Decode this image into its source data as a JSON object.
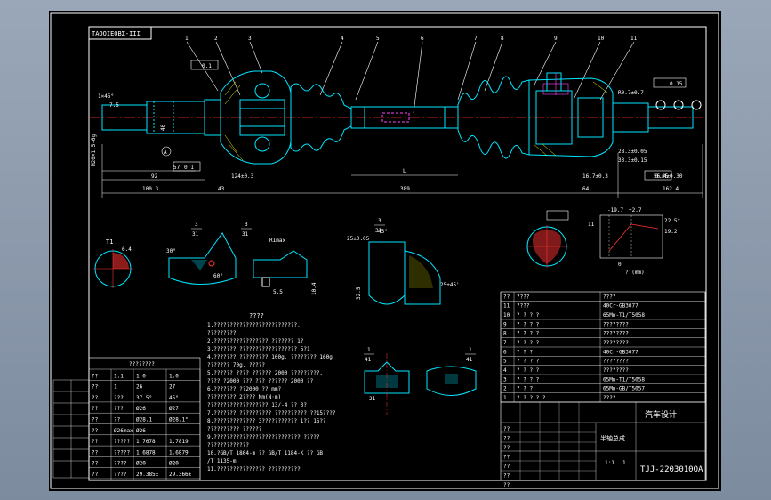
{
  "drawing": {
    "code_top": "ΤΑΟΟΙΕΟΒΣ-ΙΙΙ",
    "code_bottom": "TJJ-2203010OA",
    "company": "汽车设计",
    "part_name": "半轴总成",
    "technical_title": "????"
  },
  "balloons": [
    "1",
    "2",
    "3",
    "4",
    "5",
    "6",
    "7",
    "8",
    "9",
    "10",
    "11"
  ],
  "dimensions": {
    "d_100": "100.3",
    "d_43": "43",
    "d_389": "389",
    "d_64": "64",
    "d_162": "162.4",
    "d_92": "92",
    "d_57": "57",
    "d_124": "124±0.3",
    "d_167": "16.7±0.3",
    "d_564": "56.4±0.30",
    "d_L": "L",
    "d_283": "28.3±0.05",
    "d_333": "33.3±0.15",
    "ang_45": "1×45°",
    "d_75": "7.5",
    "m20": "M20×1.5-6g",
    "d_40": "40",
    "fig_a": "A",
    "d_r0": "R0.7±0.7",
    "tol_01": "0.1",
    "tol_015": "0.15",
    "tol_005": "0.05"
  },
  "sections": {
    "t1_label": "T1",
    "t1_w": "6.4",
    "s1_num": "3",
    "s1_den": "31",
    "s2_num": "3",
    "s2_den": "31",
    "s3_num": "3",
    "s3_den": "31",
    "s4_num": "1",
    "s4_den": "41",
    "s5_num": "1",
    "s5_den": "41",
    "ang_30": "30°",
    "ang_60": "60°",
    "ang_45b": "45°",
    "ang_25": "25±45'",
    "r_max": "R1max",
    "d_55": "5.5",
    "d_25": "25±0.05",
    "d_104": "10.4",
    "d_325": "32.5",
    "d_21": "21"
  },
  "graph": {
    "x_label": "? (mm)",
    "v1": "22.5°",
    "v2": "19.2",
    "top": "-19.7",
    "top2": "+2.7",
    "zero": "0",
    "n11": "11"
  },
  "notes": {
    "heading": "????",
    "lines": [
      "1.??????????????????????????,",
      "  ?????????",
      "2.????????????????? ??????? 1?",
      "3.??????? ?????????????????? 5?1",
      "4.??????? ????????? 100g,      ???????? 160g",
      "  ??????? 70g,      ?????",
      "5.?????? ???? ?????? 2000 ?????????.",
      "  ???? ?2000 ??? ??? ?????? 2000 ??",
      "6.??????? ??2000 ?? mm?",
      "  ????????? 2???? Nm(N·m)",
      "  ??????????????????? 13/-4 ?? 3?",
      "7.??????? ?????????? ?????????? ??15????",
      "8.????????????? 3??????????? 1?? 15??",
      "  ?????????? ??????",
      "9.??????????????????????????? ?????",
      "  ?????????????",
      "10.?GB/T 1804-m ?? GB/T 1184-K ?? GB",
      "  /T 1135-m",
      "11.??????????????? ??????????"
    ]
  },
  "param_table": {
    "title": "????????",
    "rows": [
      [
        "??",
        "1.1",
        "1.0",
        "1.0"
      ],
      [
        "??",
        "1",
        "26",
        "27"
      ],
      [
        "??",
        "???",
        "37.5°",
        "45°"
      ],
      [
        "??",
        "???",
        "Ø26",
        "Ø27"
      ],
      [
        "??",
        "??",
        "Ø28.1",
        "Ø28.1°"
      ],
      [
        "??",
        "Ø26max",
        "Ø26",
        ""
      ],
      [
        "??",
        "?????",
        "1.7678",
        "1.7819"
      ],
      [
        "??",
        "?????",
        "1.6878",
        "1.6879"
      ],
      [
        "??",
        "????",
        "Ø20",
        "Ø20"
      ],
      [
        "??",
        "????",
        "29.385±",
        "29.366±"
      ]
    ]
  },
  "bom": {
    "header": [
      "??",
      "????",
      "????"
    ],
    "rows": [
      [
        "11",
        "????",
        "40Cr-GB3077"
      ],
      [
        "10",
        "? ? ? ?",
        "65Mn-T1/T5058"
      ],
      [
        "9",
        "? ? ? ?",
        "????????"
      ],
      [
        "8",
        "? ? ? ?",
        "????????"
      ],
      [
        "7",
        "? ? ? ?",
        "????????"
      ],
      [
        "6",
        "? ? ?",
        "40Cr-GB3077"
      ],
      [
        "5",
        "? ? ? ?",
        "????????"
      ],
      [
        "4",
        "? ? ? ?",
        "????????"
      ],
      [
        "3",
        "? ? ? ?",
        "65Mn-T1/T5058"
      ],
      [
        "2",
        "? ? ?",
        "65Mn-GB/T5057"
      ],
      [
        "1",
        "? ? ? ? ?",
        "????"
      ]
    ]
  },
  "title_block": {
    "labels": [
      "??",
      "??",
      "??",
      "??",
      "??",
      "??",
      "??"
    ],
    "scale": "1:1",
    "sheet": "1"
  },
  "colors": {
    "outline": "#ffffff",
    "part": "#00e5ff",
    "center": "#ff3333",
    "dim": "#ffffff",
    "accent": "#ffff00",
    "hidden": "#ff44ff"
  }
}
